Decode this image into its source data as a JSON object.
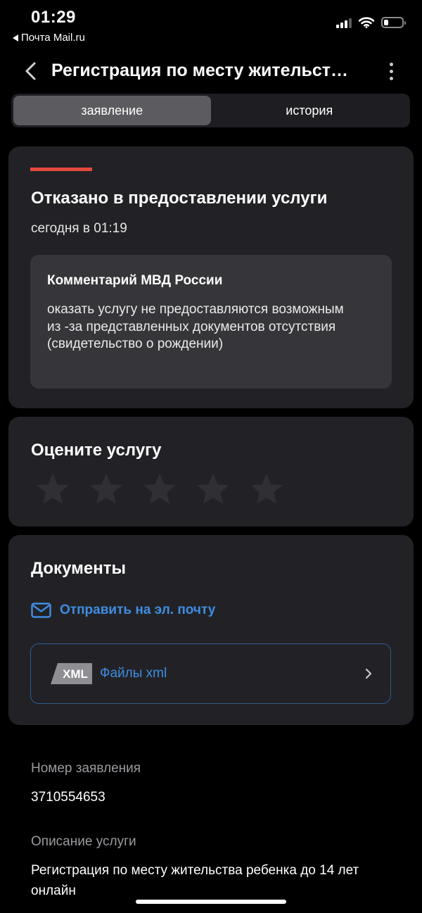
{
  "status_bar": {
    "time": "01:29",
    "back_app": "Почта Mail.ru",
    "battery_level": 0.25
  },
  "header": {
    "title": "Регистрация по месту жительст…"
  },
  "tabs": [
    {
      "label": "заявление",
      "active": true
    },
    {
      "label": "история",
      "active": false
    }
  ],
  "status_card": {
    "title": "Отказано в предоставлении услуги",
    "date": "сегодня в 01:19",
    "accent_color": "#e5493f",
    "comment": {
      "title": "Комментарий МВД России",
      "text": "оказать услугу не предоставляются возможным из -за представленных документов отсутствия (свидетельство о рождении)"
    }
  },
  "rating": {
    "title": "Оцените услугу",
    "value": 0,
    "max": 5
  },
  "documents": {
    "title": "Документы",
    "email_link": "Отправить на эл. почту",
    "xml_badge": "XML",
    "xml_label": "Файлы xml",
    "link_color": "#3f8de2"
  },
  "details": {
    "number_label": "Номер заявления",
    "number_value": "3710554653",
    "description_label": "Описание услуги",
    "description_value": "Регистрация по месту жительства ребенка до 14 лет онлайн"
  },
  "icons": {
    "back": "chevron-left-icon",
    "menu": "more-vertical-icon",
    "star": "star-icon",
    "mail": "mail-icon",
    "chevron": "chevron-right-icon"
  }
}
